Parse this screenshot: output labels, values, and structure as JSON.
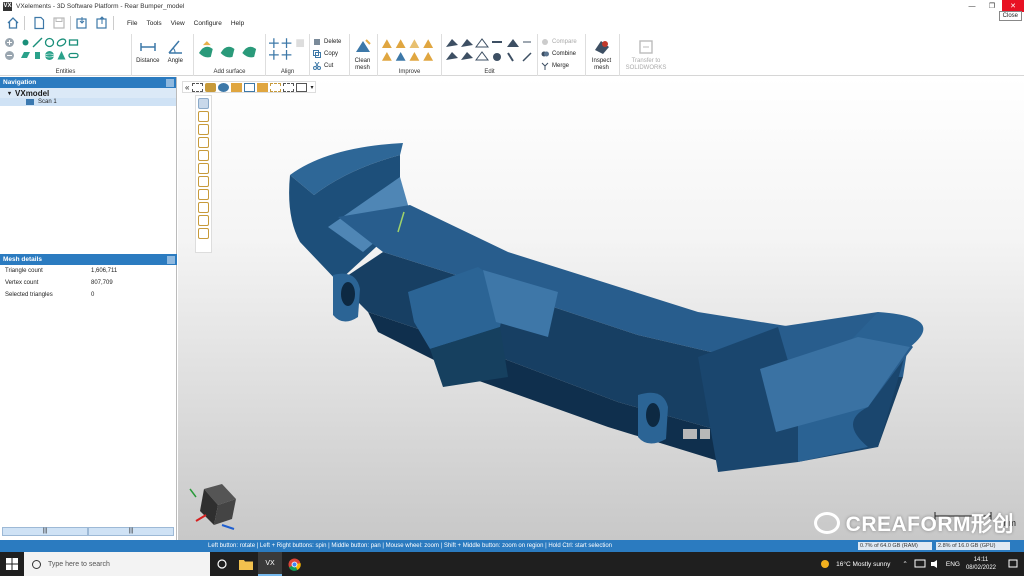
{
  "window": {
    "title": "VXelements - 3D Software Platform - Rear Bumper_model",
    "app_icon": "VX",
    "minimize": "—",
    "maximize": "❐",
    "close": "✕",
    "tooltip": "Close"
  },
  "menu": {
    "items": [
      "File",
      "Tools",
      "View",
      "Configure",
      "Help"
    ]
  },
  "ribbon": {
    "groups": {
      "entities": "Entities",
      "distance": "Distance",
      "angle": "Angle",
      "add_surface": "Add surface",
      "align": "Align",
      "improve": "Improve",
      "edit": "Edit"
    },
    "clipboard": {
      "delete": "Delete",
      "copy": "Copy",
      "cut": "Cut"
    },
    "clean_mesh": "Clean\nmesh",
    "edit_ops": {
      "compare": "Compare",
      "combine": "Combine",
      "merge": "Merge"
    },
    "inspect_mesh": "Inspect\nmesh",
    "transfer": "Transfer to\nSOLIDWORKS"
  },
  "navigation": {
    "header": "Navigation",
    "root": "VXmodel",
    "child": "Scan 1"
  },
  "mesh_details": {
    "header": "Mesh details",
    "rows": [
      {
        "label": "Triangle count",
        "value": "1,606,711"
      },
      {
        "label": "Vertex count",
        "value": "807,709"
      },
      {
        "label": "Selected triangles",
        "value": "0"
      }
    ]
  },
  "viewport": {
    "unit": "mm",
    "watermark": "CREAFORM形创",
    "colors": {
      "mesh": "#1d4f7a",
      "mesh_dark": "#0f2f4d",
      "mesh_light": "#4f86b5"
    }
  },
  "status": {
    "message": "Left button: rotate  |  Left + Right buttons: spin  |  Middle button: pan  |  Mouse wheel: zoom  |  Shift + Middle button: zoom on region  |  Hold Ctrl: start selection",
    "ram": "0.7% of 64.0 GB (RAM)",
    "gpu": "2.8% of 16.0 GB (GPU)"
  },
  "taskbar": {
    "search_placeholder": "Type here to search",
    "weather": "16°C  Mostly sunny",
    "lang": "ENG",
    "time": "14:11",
    "date": "08/02/2022"
  }
}
